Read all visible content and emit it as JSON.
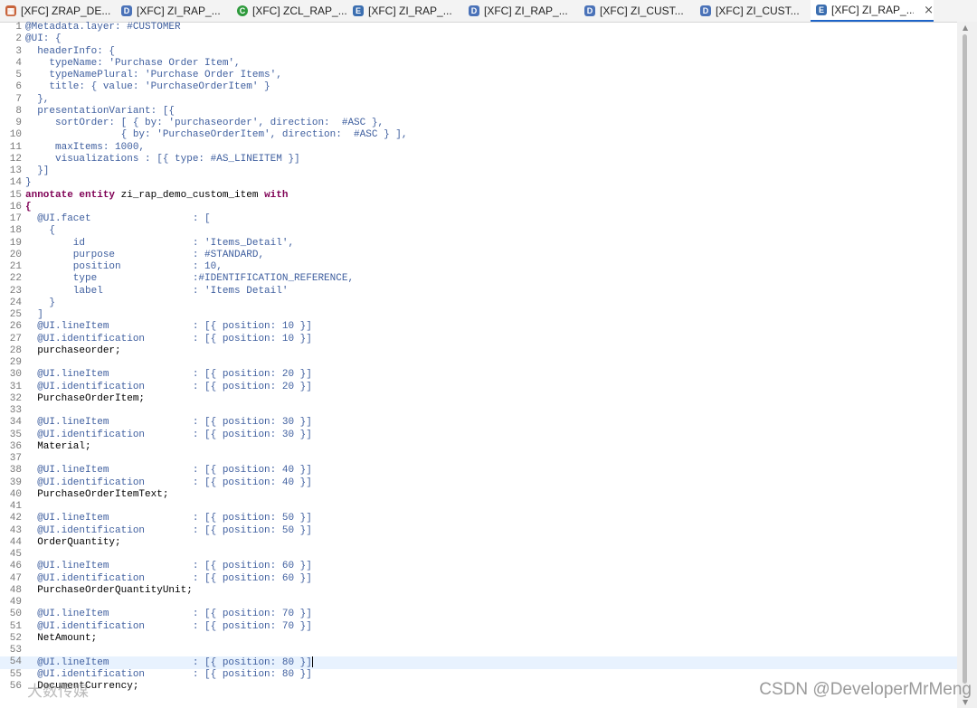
{
  "tabs": [
    {
      "label": "[XFC] ZRAP_DE...",
      "icon": "grid"
    },
    {
      "label": "[XFC] ZI_RAP_...",
      "icon": "D"
    },
    {
      "label": "[XFC] ZCL_RAP_...",
      "icon": "C"
    },
    {
      "label": "[XFC] ZI_RAP_...",
      "icon": "E"
    },
    {
      "label": "[XFC] ZI_RAP_...",
      "icon": "D"
    },
    {
      "label": "[XFC] ZI_CUST...",
      "icon": "D"
    },
    {
      "label": "[XFC] ZI_CUST...",
      "icon": "D"
    },
    {
      "label": "[XFC] ZI_RAP_...",
      "icon": "E",
      "active": true
    }
  ],
  "tab_close_symbol": "×",
  "current_line": 54,
  "colors": {
    "text": "#000000",
    "annotation": "#3f5f9f",
    "string": "#2a00ff",
    "keyword": "#7f0055",
    "line_number": "#787878",
    "current_line": "#e8f2fe"
  },
  "lines": [
    [
      [
        "ann",
        "@Metadata.layer: #CUSTOMER"
      ]
    ],
    [
      [
        "ann",
        "@UI: {"
      ]
    ],
    [
      [
        "ann",
        "  headerInfo: {"
      ]
    ],
    [
      [
        "ann",
        "    typeName: 'Purchase Order Item',"
      ]
    ],
    [
      [
        "ann",
        "    typeNamePlural: 'Purchase Order Items',"
      ]
    ],
    [
      [
        "ann",
        "    title: { value: 'PurchaseOrderItem' }"
      ]
    ],
    [
      [
        "ann",
        "  },"
      ]
    ],
    [
      [
        "ann",
        "  presentationVariant: [{"
      ]
    ],
    [
      [
        "ann",
        "     sortOrder: [ { by: 'purchaseorder', direction:  #ASC },"
      ]
    ],
    [
      [
        "ann",
        "                { by: 'PurchaseOrderItem', direction:  #ASC } ],"
      ]
    ],
    [
      [
        "ann",
        "     maxItems: 1000,"
      ]
    ],
    [
      [
        "ann",
        "     visualizations : [{ type: #AS_LINEITEM }]"
      ]
    ],
    [
      [
        "ann",
        "  }]"
      ]
    ],
    [
      [
        "ann",
        "}"
      ]
    ],
    [
      [
        "kw",
        "annotate entity "
      ],
      [
        "txt",
        "zi_rap_demo_custom_item "
      ],
      [
        "kw",
        "with"
      ]
    ],
    [
      [
        "kw",
        "{"
      ]
    ],
    [
      [
        "ann",
        "  @UI.facet                 : ["
      ]
    ],
    [
      [
        "ann",
        "    {"
      ]
    ],
    [
      [
        "ann",
        "        id                  : 'Items_Detail',"
      ]
    ],
    [
      [
        "ann",
        "        purpose             : #STANDARD,"
      ]
    ],
    [
      [
        "ann",
        "        position            : 10,"
      ]
    ],
    [
      [
        "ann",
        "        type                :#IDENTIFICATION_REFERENCE,"
      ]
    ],
    [
      [
        "ann",
        "        label               : 'Items Detail'"
      ]
    ],
    [
      [
        "ann",
        "    }"
      ]
    ],
    [
      [
        "ann",
        "  ]"
      ]
    ],
    [
      [
        "ann",
        "  @UI.lineItem              : [{ position: 10 }]"
      ]
    ],
    [
      [
        "ann",
        "  @UI.identification        : [{ position: 10 }]"
      ]
    ],
    [
      [
        "txt",
        "  purchaseorder;"
      ]
    ],
    [
      [
        "txt",
        ""
      ]
    ],
    [
      [
        "ann",
        "  @UI.lineItem              : [{ position: 20 }]"
      ]
    ],
    [
      [
        "ann",
        "  @UI.identification        : [{ position: 20 }]"
      ]
    ],
    [
      [
        "txt",
        "  PurchaseOrderItem;"
      ]
    ],
    [
      [
        "txt",
        ""
      ]
    ],
    [
      [
        "ann",
        "  @UI.lineItem              : [{ position: 30 }]"
      ]
    ],
    [
      [
        "ann",
        "  @UI.identification        : [{ position: 30 }]"
      ]
    ],
    [
      [
        "txt",
        "  Material;"
      ]
    ],
    [
      [
        "txt",
        ""
      ]
    ],
    [
      [
        "ann",
        "  @UI.lineItem              : [{ position: 40 }]"
      ]
    ],
    [
      [
        "ann",
        "  @UI.identification        : [{ position: 40 }]"
      ]
    ],
    [
      [
        "txt",
        "  PurchaseOrderItemText;"
      ]
    ],
    [
      [
        "txt",
        ""
      ]
    ],
    [
      [
        "ann",
        "  @UI.lineItem              : [{ position: 50 }]"
      ]
    ],
    [
      [
        "ann",
        "  @UI.identification        : [{ position: 50 }]"
      ]
    ],
    [
      [
        "txt",
        "  OrderQuantity;"
      ]
    ],
    [
      [
        "txt",
        ""
      ]
    ],
    [
      [
        "ann",
        "  @UI.lineItem              : [{ position: 60 }]"
      ]
    ],
    [
      [
        "ann",
        "  @UI.identification        : [{ position: 60 }]"
      ]
    ],
    [
      [
        "txt",
        "  PurchaseOrderQuantityUnit;"
      ]
    ],
    [
      [
        "txt",
        ""
      ]
    ],
    [
      [
        "ann",
        "  @UI.lineItem              : [{ position: 70 }]"
      ]
    ],
    [
      [
        "ann",
        "  @UI.identification        : [{ position: 70 }]"
      ]
    ],
    [
      [
        "txt",
        "  NetAmount;"
      ]
    ],
    [
      [
        "txt",
        ""
      ]
    ],
    [
      [
        "ann",
        "  @UI.lineItem              : [{ position: 80 }]"
      ]
    ],
    [
      [
        "ann",
        "  @UI.identification        : [{ position: 80 }]"
      ]
    ],
    [
      [
        "txt",
        "  DocumentCurrency;"
      ]
    ]
  ],
  "watermark": "CSDN @DeveloperMrMeng",
  "watermark_overlay": "大数传媒"
}
